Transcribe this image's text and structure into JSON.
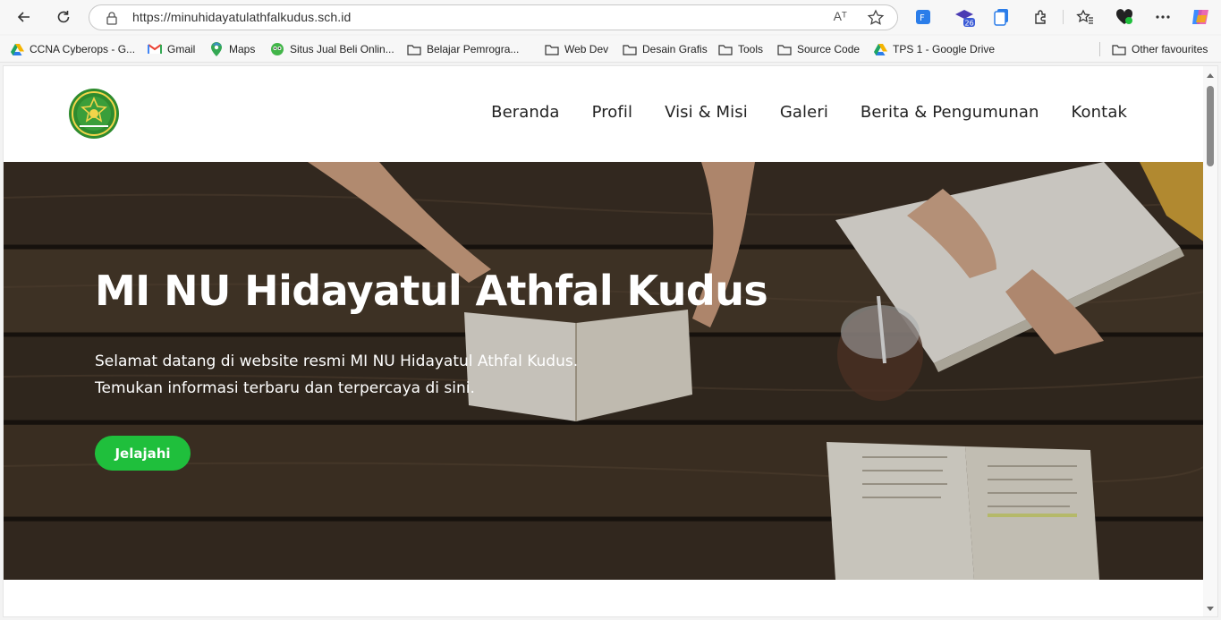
{
  "browser": {
    "url": "https://minuhidayatulathfalkudus.sch.id",
    "read_aloud_label": "Aᵀ",
    "badge_count": "26"
  },
  "bookmarks": [
    {
      "label": "CCNA Cyberops - G...",
      "icon": "google-drive-icon"
    },
    {
      "label": "Gmail",
      "icon": "gmail-icon"
    },
    {
      "label": "Maps",
      "icon": "maps-icon"
    },
    {
      "label": "Situs Jual Beli Onlin...",
      "icon": "tokopedia-icon"
    },
    {
      "label": "Belajar Pemrogra...",
      "icon": "folder-icon"
    },
    {
      "label": "Web Dev",
      "icon": "folder-icon"
    },
    {
      "label": "Desain Grafis",
      "icon": "folder-icon"
    },
    {
      "label": "Tools",
      "icon": "folder-icon"
    },
    {
      "label": "Source Code",
      "icon": "folder-icon"
    },
    {
      "label": "TPS 1 - Google Drive",
      "icon": "google-drive-icon"
    },
    {
      "label": "Other favourites",
      "icon": "folder-icon"
    }
  ],
  "site": {
    "nav": [
      "Beranda",
      "Profil",
      "Visi & Misi",
      "Galeri",
      "Berita & Pengumunan",
      "Kontak"
    ],
    "hero": {
      "title": "MI NU Hidayatul Athfal Kudus",
      "line1": "Selamat datang di website resmi MI NU Hidayatul Athfal Kudus.",
      "line2": "Temukan informasi terbaru dan terpercaya di sini.",
      "button": "Jelajahi"
    }
  },
  "colors": {
    "accent_green": "#1fbf3c",
    "logo_green": "#2e8b2e"
  }
}
